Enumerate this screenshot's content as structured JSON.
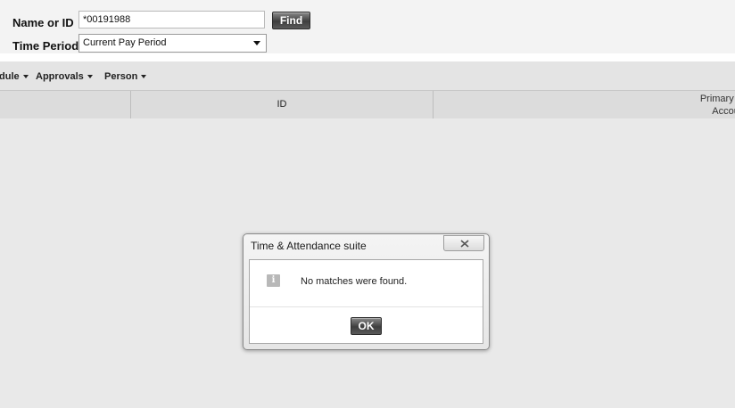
{
  "search": {
    "name_label": "Name or ID",
    "name_value": "*00191988",
    "find_label": "Find",
    "period_label": "Time Period",
    "period_value": "Current Pay Period"
  },
  "menu": {
    "items": [
      {
        "label": "dule"
      },
      {
        "label": "Approvals"
      },
      {
        "label": "Person"
      }
    ]
  },
  "grid": {
    "columns": {
      "id": "ID",
      "primary_line1": "Primary La",
      "primary_line2": "Account"
    }
  },
  "dialog": {
    "title": "Time & Attendance suite",
    "message": "No matches were found.",
    "ok_label": "OK",
    "icon": "info-icon",
    "close_icon": "close-icon"
  }
}
